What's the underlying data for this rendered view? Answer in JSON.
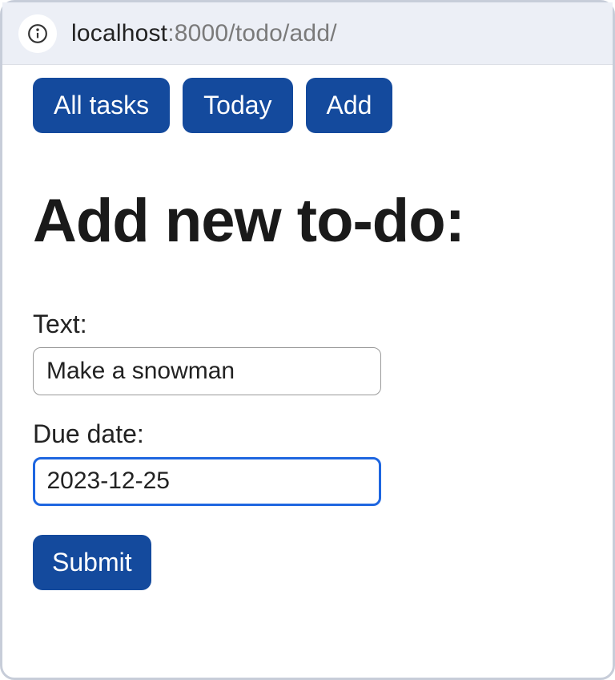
{
  "browser": {
    "url_host": "localhost",
    "url_path": ":8000/todo/add/"
  },
  "nav": {
    "all_tasks": "All tasks",
    "today": "Today",
    "add": "Add"
  },
  "page": {
    "heading": "Add new to-do:"
  },
  "form": {
    "text_label": "Text:",
    "text_value": "Make a snowman",
    "due_label": "Due date:",
    "due_value": "2023-12-25",
    "submit_label": "Submit"
  }
}
